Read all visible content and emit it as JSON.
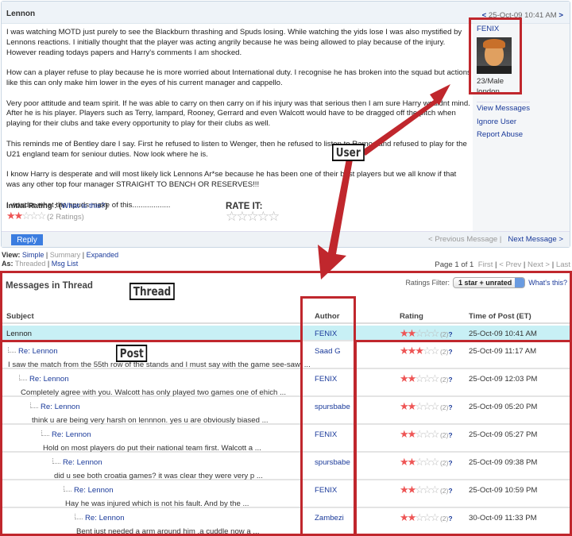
{
  "message": {
    "title": "Lennon",
    "date": "25-Oct-09 10:41 AM",
    "prev_arrow": "<",
    "next_arrow": ">",
    "paragraphs": [
      "I was watching MOTD just purely to see the Blackburn thrashing and Spuds losing. While watching the yids lose I was also mystified by Lennons reactions. I initially thought that the player was acting angrily because he was being allowed to play because of the injury. However reading todays papers and Harry's comments I am shocked.",
      "How can a player refuse to play because he is more worried about International duty. I recognise he has broken into the squad but actions like this can only make him lower in the eyes of his current manager and cappello.",
      "Very poor attitude and team spirit. If he was able to carry on then carry on if his injury was that serious then I am sure Harry wouldnt mind. After he is his player. Players such as Terry, lampard, Rooney, Gerrard and even Walcott would have to be dragged off the pitch when playing for their clubs and take every opportunity to play for their clubs as well.",
      "This reminds me of Bentley dare I say. First he refused to listen to Wenger, then he refused to listen to Ramos and refused to play for the U21 england team for seniour duties. Now look where he is.",
      "I know Harry is desperate and will most likely lick Lennons Ar*se because he has been one of their best players but we all know if that was any other top four manager STRAIGHT TO BENCH OR RESERVES!!!",
      "I wonder what the spuds make of this.................."
    ],
    "initial_rating_label": "Initial Rating : (",
    "what_is_this": "What is this?",
    "close_paren": ")",
    "rating_value": 2,
    "rating_count": "(2 Ratings)",
    "rate_it": "RATE IT:",
    "reply": "Reply",
    "previous_message": "< Previous Message",
    "next_message": "Next Message >"
  },
  "user": {
    "name": "FENIX",
    "info1": "23/Male",
    "info2": "london",
    "links": [
      "View Messages",
      "Ignore User",
      "Report Abuse"
    ]
  },
  "view": {
    "view_label": "View:",
    "simple": "Simple",
    "summary": "Summary",
    "expanded": "Expanded",
    "as_label": "As:",
    "threaded": "Threaded",
    "msg_list": "Msg List"
  },
  "pager": {
    "page": "Page 1 of 1",
    "first": "First",
    "prev": "< Prev",
    "next": "Next >",
    "last": "Last"
  },
  "thread": {
    "title": "Messages in Thread",
    "filter_label": "Ratings Filter:",
    "filter_value": "1 star + unrated",
    "whats_this": "What's this?",
    "columns": [
      "Subject",
      "Author",
      "Rating",
      "Time of Post (ET)"
    ],
    "rows": [
      {
        "subject": "Lennon",
        "preview": "",
        "author": "FENIX",
        "stars": 2,
        "count": "(2)",
        "time": "25-Oct-09 10:41 AM",
        "depth": 0
      },
      {
        "subject": "Re: Lennon",
        "preview": "I saw the match from the 55th row of the stands and I must say with the game see-sawi ...",
        "author": "Saad G",
        "stars": 3,
        "count": "(2)",
        "time": "25-Oct-09 11:17 AM",
        "depth": 1
      },
      {
        "subject": "Re: Lennon",
        "preview": "Completely agree with you. Walcott has only played two games one of ehich ...",
        "author": "FENIX",
        "stars": 2,
        "count": "(2)",
        "time": "25-Oct-09 12:03 PM",
        "depth": 2
      },
      {
        "subject": "Re: Lennon",
        "preview": "think u are being very harsh on lennnon. yes u are obviously biased ...",
        "author": "spursbabe",
        "stars": 2,
        "count": "(2)",
        "time": "25-Oct-09 05:20 PM",
        "depth": 3
      },
      {
        "subject": "Re: Lennon",
        "preview": "Hold on most players do put their national team first. Walcott a ...",
        "author": "FENIX",
        "stars": 2,
        "count": "(2)",
        "time": "25-Oct-09 05:27 PM",
        "depth": 4
      },
      {
        "subject": "Re: Lennon",
        "preview": "did u see both croatia games? it was clear they were very p ...",
        "author": "spursbabe",
        "stars": 2,
        "count": "(2)",
        "time": "25-Oct-09 09:38 PM",
        "depth": 5
      },
      {
        "subject": "Re: Lennon",
        "preview": "Hay he was injured which is not his fault. And by the ...",
        "author": "FENIX",
        "stars": 2,
        "count": "(2)",
        "time": "25-Oct-09 10:59 PM",
        "depth": 6
      },
      {
        "subject": "Re: Lennon",
        "preview": "Bent just needed a arm around him ,a cuddle now a ...",
        "author": "Zambezi",
        "stars": 2,
        "count": "(2)",
        "time": "30-Oct-09 11:33 PM",
        "depth": 7
      }
    ],
    "question": "?",
    "selected_row_color": "#c8f0f5"
  },
  "annotations": {
    "user": "User",
    "thread": "Thread",
    "post": "Post",
    "color": "#c0272d"
  }
}
